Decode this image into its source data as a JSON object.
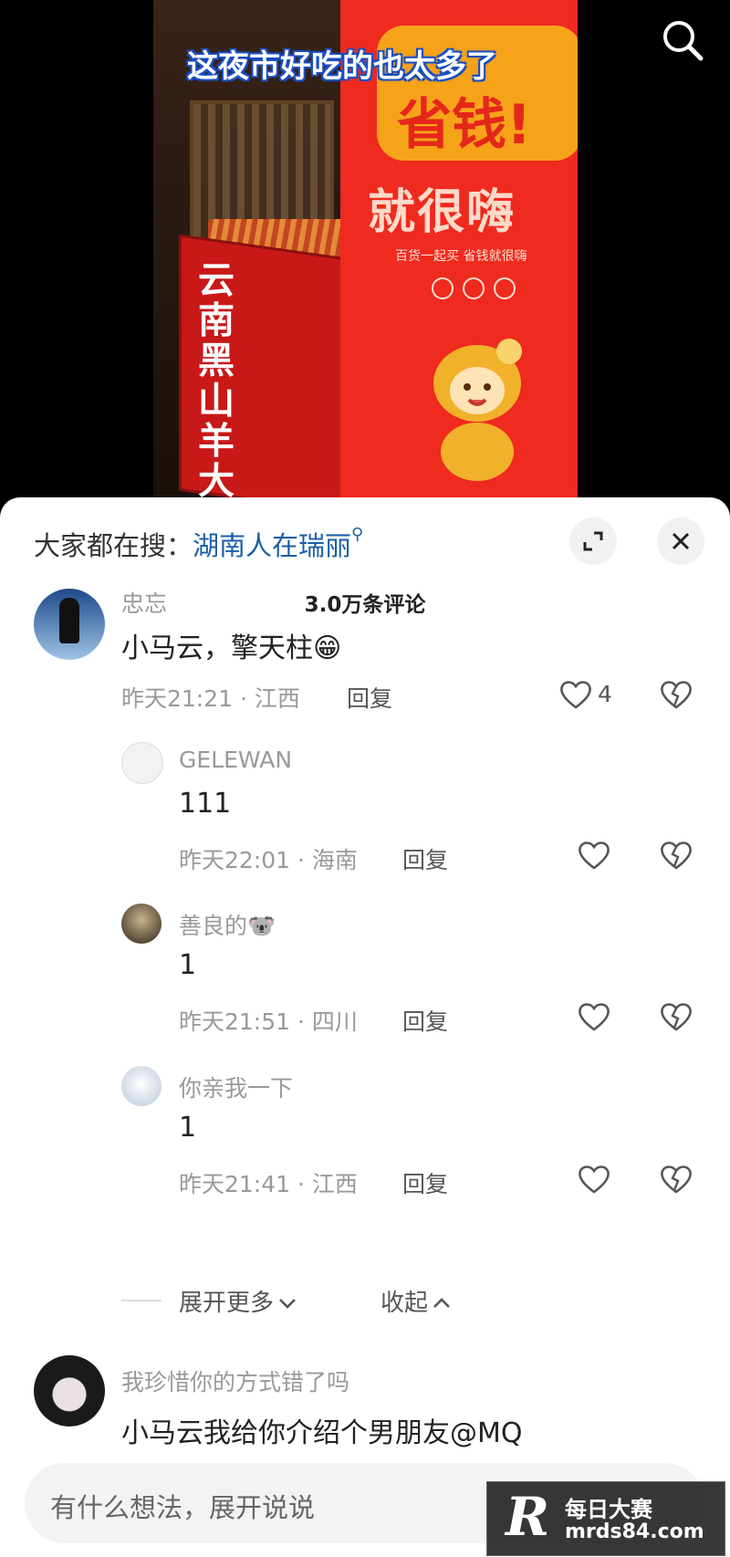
{
  "video": {
    "caption": "这夜市好吃的也太多了",
    "stall_sign": "云南黑山羊大烤串",
    "banner_top": "省钱!",
    "banner_main": "就很嗨",
    "banner_sub": "百货一起买 省钱就很嗨"
  },
  "sheet": {
    "trending_prefix": "大家都在搜：",
    "trending_keyword": "湖南人在瑞丽",
    "comment_count": "3.0万条评论"
  },
  "comments": [
    {
      "username": "忠忘",
      "text": "小马云，擎天柱😁",
      "meta": "昨天21:21 · 江西",
      "reply": "回复",
      "likes": "4"
    },
    {
      "username": "GELEWAN",
      "text": "111",
      "meta": "昨天22:01 · 海南",
      "reply": "回复"
    },
    {
      "username": "善良的🐨",
      "text": "1",
      "meta": "昨天21:51 · 四川",
      "reply": "回复"
    },
    {
      "username": "你亲我一下",
      "text": "1",
      "meta": "昨天21:41 · 江西",
      "reply": "回复"
    },
    {
      "username": "我珍惜你的方式错了吗",
      "text": "小马云我给你介绍个男朋友@MQ"
    }
  ],
  "replies_controls": {
    "expand": "展开更多",
    "collapse": "收起"
  },
  "input": {
    "placeholder": "有什么想法，展开说说"
  },
  "watermark": {
    "logo": "R",
    "line1": "每日大赛",
    "line2": "mrds84.com"
  },
  "colors": {
    "accent_link": "#1a5ea8",
    "banner_red": "#ef2a1f"
  }
}
